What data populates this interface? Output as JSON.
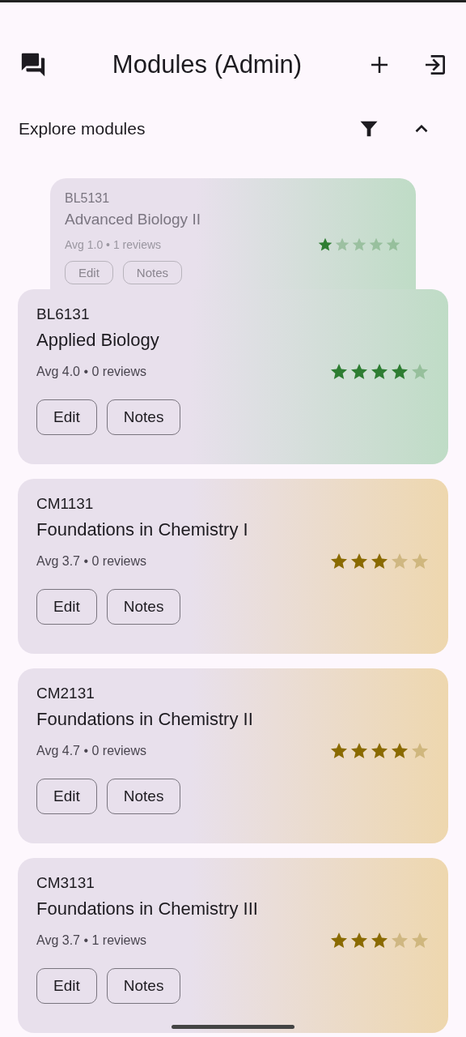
{
  "app_bar": {
    "title": "Modules (Admin)"
  },
  "section": {
    "title": "Explore modules",
    "expanded": true
  },
  "modules": [
    {
      "kind": "stacked",
      "code": "BL5131",
      "name": "Advanced Biology II",
      "stats": "Avg 1.0 • 1 reviews",
      "stars": 1,
      "color": "#2e7d32",
      "buttons": [
        "Edit",
        "Notes"
      ]
    },
    {
      "kind": "card",
      "code": "BL6131",
      "name": "Applied Biology",
      "stats": "Avg 4.0 • 0 reviews",
      "stars": 4,
      "color": "#2e7d32",
      "buttons": [
        "Edit",
        "Notes"
      ]
    },
    {
      "kind": "card",
      "code": "CM1131",
      "name": "Foundations in Chemistry I",
      "stats": "Avg 3.7 • 0 reviews",
      "stars": 3,
      "color": "#8a6a00",
      "buttons": [
        "Edit",
        "Notes"
      ]
    },
    {
      "kind": "card",
      "code": "CM2131",
      "name": "Foundations in Chemistry II",
      "stats": "Avg 4.7 • 0 reviews",
      "stars": 4,
      "color": "#8a6a00",
      "buttons": [
        "Edit",
        "Notes"
      ]
    },
    {
      "kind": "card",
      "code": "CM3131",
      "name": "Foundations in Chemistry III",
      "stats": "Avg 3.7 • 1 reviews",
      "stars": 3,
      "color": "#8a6a00",
      "buttons": [
        "Edit",
        "Notes"
      ]
    }
  ]
}
